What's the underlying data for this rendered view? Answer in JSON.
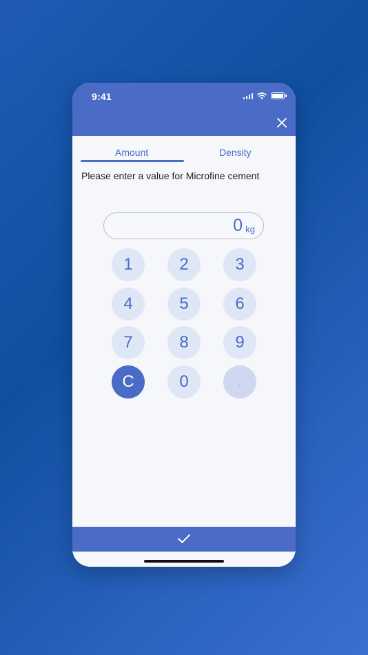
{
  "status_bar": {
    "time": "9:41"
  },
  "tabs": [
    {
      "label": "Amount",
      "active": true
    },
    {
      "label": "Density",
      "active": false
    }
  ],
  "prompt": "Please enter a value for Microfine cement",
  "display": {
    "value": "0",
    "unit": "kg"
  },
  "keypad": {
    "keys": [
      "1",
      "2",
      "3",
      "4",
      "5",
      "6",
      "7",
      "8",
      "9",
      "C",
      "0",
      "."
    ]
  },
  "icons": {
    "close": "close-icon",
    "confirm": "checkmark-icon",
    "signal": "signal-icon",
    "wifi": "wifi-icon",
    "battery": "battery-icon"
  },
  "colors": {
    "accent": "#4a6cc6",
    "key_background": "#dfe6f6",
    "background_gradient_start": "#1f5bb5",
    "background_gradient_end": "#3a6fd0"
  }
}
